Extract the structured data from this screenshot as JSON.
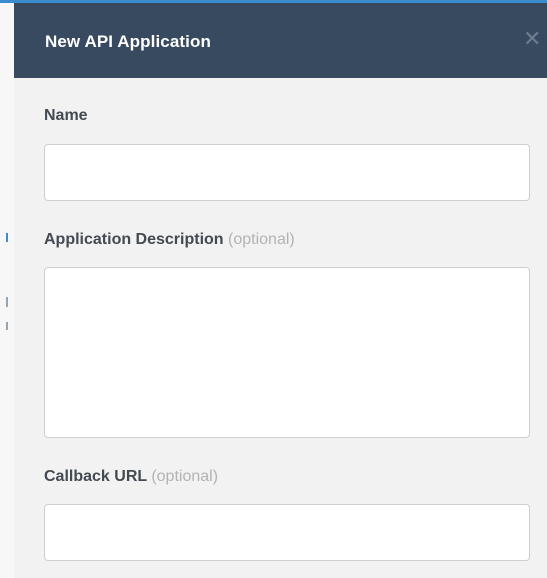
{
  "modal": {
    "title": "New API Application",
    "close_glyph": "✕",
    "close_icon": "close-icon"
  },
  "form": {
    "name": {
      "label": "Name",
      "value": "",
      "placeholder": ""
    },
    "description": {
      "label": "Application Description",
      "optional_label": "(optional)",
      "value": "",
      "placeholder": ""
    },
    "callback_url": {
      "label": "Callback URL",
      "optional_label": "(optional)",
      "value": "",
      "placeholder": ""
    }
  },
  "colors": {
    "header_background": "#384a5f",
    "panel_background": "#f2f2f2",
    "label_text": "#444a52",
    "optional_text": "#b3b3b3",
    "accent": "#3a8ccf"
  }
}
